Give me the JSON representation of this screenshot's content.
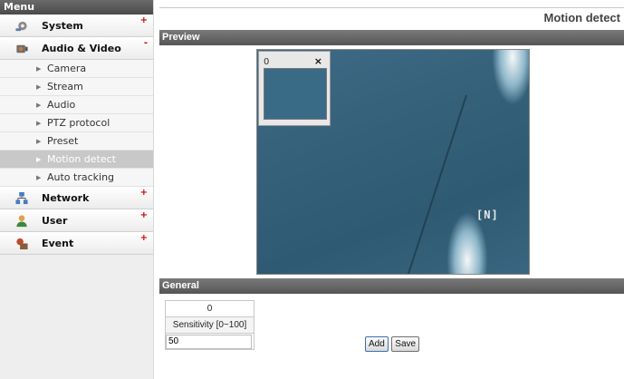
{
  "sidebar": {
    "header": "Menu",
    "categories": [
      {
        "label": "System",
        "toggle": "+",
        "icon": "gear-icon"
      },
      {
        "label": "Audio & Video",
        "toggle": "-",
        "icon": "camera-icon"
      },
      {
        "label": "Network",
        "toggle": "+",
        "icon": "network-icon"
      },
      {
        "label": "User",
        "toggle": "+",
        "icon": "user-icon"
      },
      {
        "label": "Event",
        "toggle": "+",
        "icon": "event-icon"
      }
    ],
    "sub_items": [
      {
        "label": "Camera"
      },
      {
        "label": "Stream"
      },
      {
        "label": "Audio"
      },
      {
        "label": "PTZ protocol"
      },
      {
        "label": "Preset"
      },
      {
        "label": "Motion detect",
        "active": true
      },
      {
        "label": "Auto tracking"
      }
    ]
  },
  "main": {
    "page_title": "Motion detect",
    "preview_heading": "Preview",
    "region": {
      "id": "0",
      "close": "×"
    },
    "osd_text": "[N]",
    "general_heading": "General",
    "table": {
      "column_value": "0",
      "sensitivity_label": "Sensitivity [0~100]",
      "sensitivity_value": "50"
    },
    "buttons": {
      "add": "Add",
      "save": "Save"
    }
  },
  "colors": {
    "section_bar": "#5e5e5e",
    "active_menu": "#c8c8c8",
    "toggle_sign": "#d40000",
    "video_tint": "#3a6b86"
  }
}
